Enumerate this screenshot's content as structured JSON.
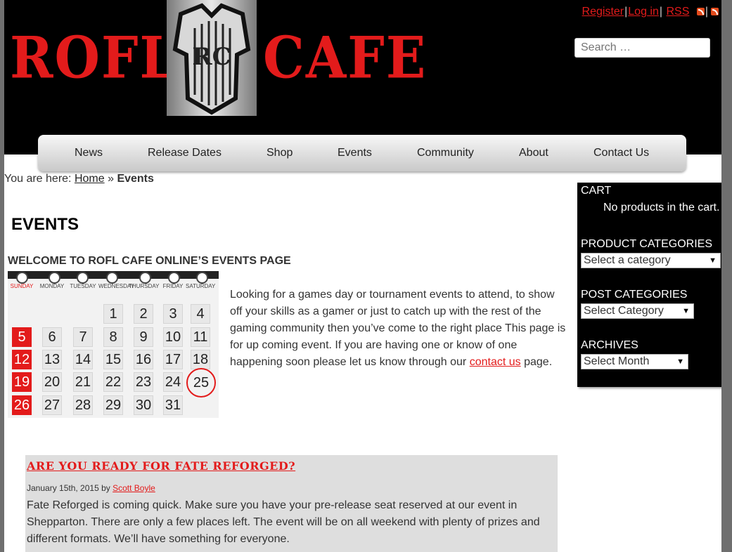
{
  "header": {
    "logo_left": "ROFL",
    "logo_right": "CAFE",
    "emblem_text": "RC",
    "links": {
      "register": "Register",
      "login": "Log in",
      "rss": "RSS"
    },
    "search_placeholder": "Search …"
  },
  "nav": {
    "items": [
      {
        "label": "News"
      },
      {
        "label": "Release Dates"
      },
      {
        "label": "Shop"
      },
      {
        "label": "Events"
      },
      {
        "label": "Community"
      },
      {
        "label": "About"
      },
      {
        "label": "Contact Us"
      }
    ]
  },
  "breadcrumb": {
    "prefix": "You are here:",
    "home": "Home",
    "separator": "»",
    "current": "Events"
  },
  "main": {
    "title": "EVENTS",
    "welcome_heading": "WELCOME TO ROFL CAFE ONLINE’S EVENTS PAGE",
    "intro_before_link": "Looking for a games day or tournament events to attend, to show off your skills as a gamer or just to catch up with the rest of the gaming community then you’ve come to the right place This page is for up coming event. If you are having one or know of one happening soon please let us know through our",
    "intro_link": "contact us",
    "intro_after_link": "page."
  },
  "calendar": {
    "days": [
      "SUNDAY",
      "MONDAY",
      "TUESDAY",
      "WEDNESDAY",
      "THURSDAY",
      "FRIDAY",
      "SATURDAY"
    ],
    "weeks": [
      [
        "",
        "",
        "",
        "1",
        "2",
        "3",
        "4"
      ],
      [
        "5",
        "6",
        "7",
        "8",
        "9",
        "10",
        "11"
      ],
      [
        "12",
        "13",
        "14",
        "15",
        "16",
        "17",
        "18"
      ],
      [
        "19",
        "20",
        "21",
        "22",
        "23",
        "24",
        "25"
      ],
      [
        "26",
        "27",
        "28",
        "29",
        "30",
        "31",
        ""
      ]
    ],
    "circled_day": "25"
  },
  "post": {
    "title": "ARE YOU READY FOR FATE REFORGED?",
    "date": "January 15th, 2015",
    "by": "by",
    "author": "Scott Boyle",
    "body": "Fate Reforged is coming quick. Make sure you have your pre-release seat reserved at our event in Shepparton. There are only a few places left. The event will be on all weekend with plenty of prizes and different formats. We’ll have something for everyone."
  },
  "sidebar": {
    "cart_heading": "CART",
    "cart_empty": "No products in the cart.",
    "product_categories_heading": "PRODUCT CATEGORIES",
    "product_categories_select": "Select a category",
    "post_categories_heading": "POST CATEGORIES",
    "post_categories_select": "Select Category",
    "archives_heading": "ARCHIVES",
    "archives_select": "Select Month"
  },
  "colors": {
    "accent": "#e31b1b",
    "header_bg": "#000000",
    "post_bg": "#dedede"
  }
}
